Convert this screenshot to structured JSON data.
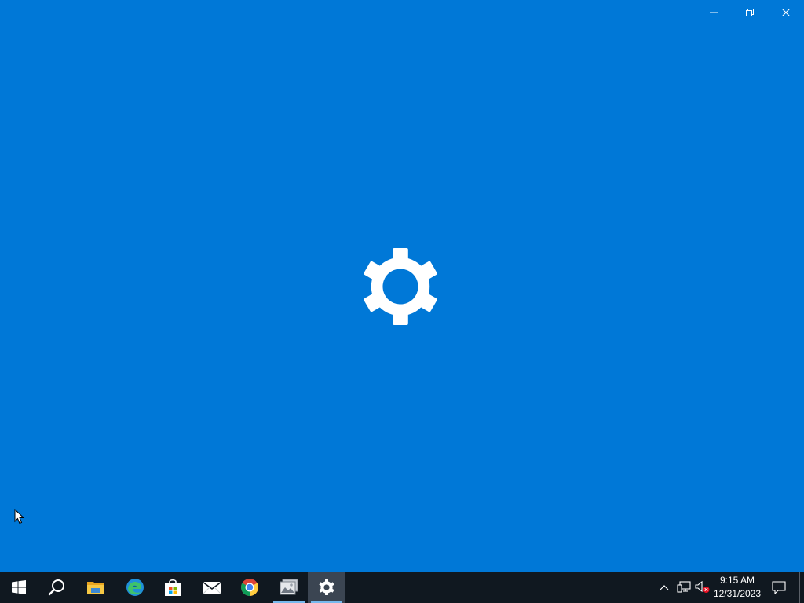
{
  "colors": {
    "splash_background": "#0078d7",
    "taskbar_background": "#101820",
    "running_indicator": "#76b9ed"
  },
  "window": {
    "app": "Settings",
    "splash_icon": "gear-icon",
    "caption_buttons": [
      "minimize",
      "restore",
      "close"
    ]
  },
  "taskbar": {
    "pinned": [
      {
        "name": "start",
        "icon": "windows-logo-icon",
        "running": false
      },
      {
        "name": "search",
        "icon": "search-icon",
        "running": false
      },
      {
        "name": "file-explorer",
        "icon": "folder-icon",
        "running": false
      },
      {
        "name": "edge",
        "icon": "edge-icon",
        "running": false
      },
      {
        "name": "store",
        "icon": "store-icon",
        "running": false
      },
      {
        "name": "mail",
        "icon": "mail-icon",
        "running": false
      },
      {
        "name": "chrome",
        "icon": "chrome-icon",
        "running": false
      },
      {
        "name": "image-viewer",
        "icon": "image-app-icon",
        "running": true
      },
      {
        "name": "settings",
        "icon": "gear-icon",
        "running": true,
        "active": true
      }
    ],
    "tray": {
      "time": "9:15 AM",
      "date": "12/31/2023",
      "icons": [
        "chevron-up-icon",
        "network-icon",
        "volume-muted-icon",
        "notification-icon"
      ]
    }
  }
}
